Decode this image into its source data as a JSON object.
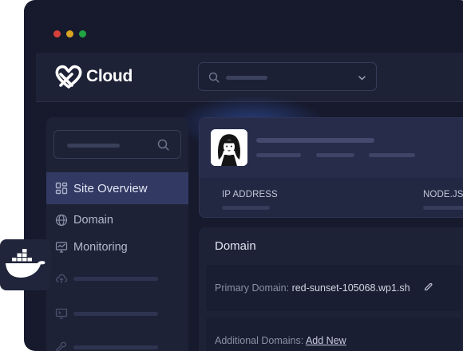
{
  "window": {
    "controls": [
      "close",
      "minimize",
      "maximize"
    ]
  },
  "header": {
    "logo_text": "Cloud",
    "logo_icon": "heart-x-logo",
    "search_icon": "search-icon",
    "dropdown_icon": "chevron-down-icon"
  },
  "sidebar": {
    "search_icon": "search-icon",
    "items": [
      {
        "label": "Site Overview",
        "icon": "grid-icon",
        "active": true
      },
      {
        "label": "Domain",
        "icon": "globe-icon",
        "active": false
      },
      {
        "label": "Monitoring",
        "icon": "monitor-icon",
        "active": false
      },
      {
        "label": "",
        "icon": "cloud-upload-icon",
        "active": false
      },
      {
        "label": "",
        "icon": "terminal-icon",
        "active": false
      },
      {
        "label": "",
        "icon": "tools-icon",
        "active": false
      }
    ]
  },
  "site": {
    "avatar": "site-avatar-image",
    "stats": [
      {
        "label": "IP ADDRESS"
      },
      {
        "label": "NODE.JS"
      }
    ]
  },
  "domain": {
    "title": "Domain",
    "primary_label": "Primary Domain:",
    "primary_value": "red-sunset-105068.wp1.sh",
    "additional_label": "Additional Domains:",
    "add_new": "Add New"
  },
  "overlay": {
    "icon": "docker-whale-icon"
  },
  "colors": {
    "background": "#171a2d",
    "panel": "#1e2237",
    "active_item": "#323a64",
    "accent_glow": "#3c6ee6"
  }
}
